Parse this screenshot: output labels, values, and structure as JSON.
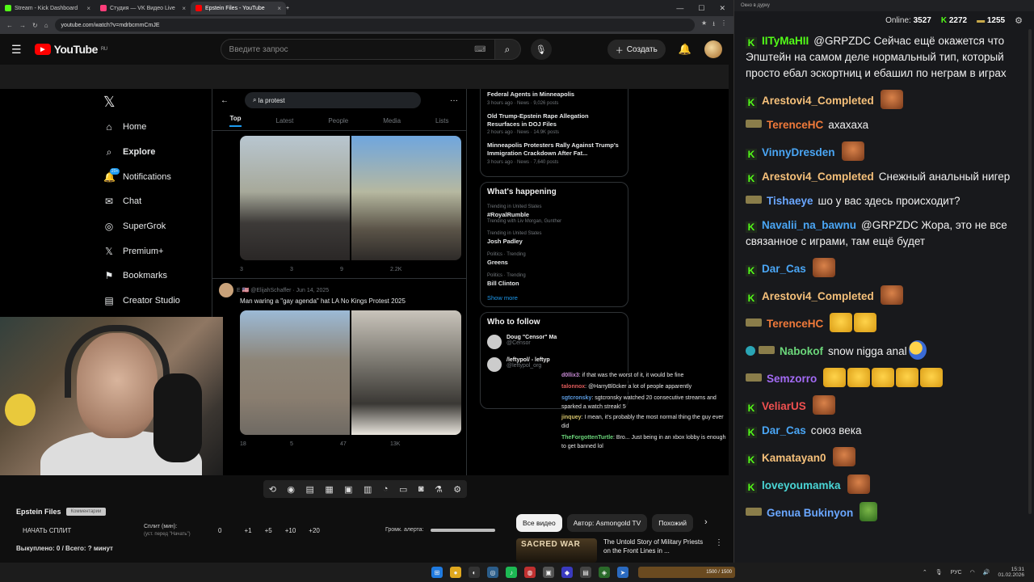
{
  "browser": {
    "tabs": [
      {
        "label": "Stream - Kick Dashboard",
        "color": "#53fc18"
      },
      {
        "label": "Студия — VK Видео Live",
        "color": "#ff3d7a"
      },
      {
        "label": "Epstein Files - YouTube",
        "color": "#ff0000"
      }
    ],
    "url": "youtube.com/watch?v=mdrbcmmCmJE"
  },
  "youtube": {
    "logo": "YouTube",
    "region": "RU",
    "search_placeholder": "Введите запрос",
    "create_label": "Создать",
    "video_title": "Epstein Files",
    "tag_label": "Комментарии",
    "split_button": "НАЧАТЬ СПЛИТ",
    "split_label": "Сплит (мин):",
    "split_hint": "(уст. перед \"Начать\")",
    "split_values": [
      "0",
      "+1",
      "+5",
      "+10",
      "+20"
    ],
    "alert_label": "Громк. алерта:",
    "bought": "Выкуплено: 0 / Всего: ? минут",
    "chips": [
      "Все видео",
      "Автор: Asmongold TV",
      "Похожий"
    ],
    "rec_thumb": "SACRED WAR",
    "rec_title": "The Untold Story of Military Priests on the Front Lines in ..."
  },
  "x": {
    "nav": [
      "Home",
      "Explore",
      "Notifications",
      "Chat",
      "SuperGrok",
      "Premium+",
      "Bookmarks",
      "Creator Studio"
    ],
    "notif_badge": "20+",
    "search_value": "la protest",
    "tabs": [
      "Top",
      "Latest",
      "People",
      "Media",
      "Lists"
    ],
    "tweet1_actions": [
      "3",
      "3",
      "9",
      "2.2K"
    ],
    "tweet2_handle": "E 🇺🇸 @ElijahSchaffer · Jun 14, 2025",
    "tweet2_text": "Man waring a \"gay agenda\" hat LA No Kings Protest 2025",
    "tweet2_actions": [
      "18",
      "5",
      "47",
      "13K"
    ],
    "news": [
      {
        "title": "Federal Agents in Minneapolis",
        "meta": "3 hours ago · News · 9,026 posts"
      },
      {
        "title": "Old Trump-Epstein Rape Allegation Resurfaces in DOJ Files",
        "meta": "2 hours ago · News · 14.9K posts"
      },
      {
        "title": "Minneapolis Protesters Rally Against Trump's Immigration Crackdown After Fat...",
        "meta": "3 hours ago · News · 7,640 posts"
      }
    ],
    "whats_happening": "What's happening",
    "trends": [
      {
        "cat": "Trending in United States",
        "name": "#RoyalRumble",
        "sub": "Trending with Liv Morgan, Gunther"
      },
      {
        "cat": "Trending in United States",
        "name": "Josh Padley",
        "sub": ""
      },
      {
        "cat": "Politics · Trending",
        "name": "Greens",
        "sub": ""
      },
      {
        "cat": "Politics · Trending",
        "name": "Bill Clinton",
        "sub": ""
      }
    ],
    "show_more": "Show more",
    "who_to_follow": "Who to follow",
    "follow": [
      {
        "name": "Doug \"Censor\" Ma",
        "handle": "@Censor"
      },
      {
        "name": "/leftypol/ - leftyp",
        "handle": "@leftypol_org"
      }
    ]
  },
  "overlay_chat": [
    {
      "user": "d0llix3",
      "text": "if that was the worst of it, it would be fine",
      "color": "#c98bd6"
    },
    {
      "user": "talonnox",
      "text": "@HarryBl0cker a lot of people apparently",
      "color": "#e05b5b"
    },
    {
      "user": "sgtcronsky",
      "text": "sgtcronsky watched 20 consecutive streams and sparked a watch streak! 5",
      "color": "#5b9be0"
    },
    {
      "user": "jinquey",
      "text": "I mean, it's probably the most normal thing the guy ever did",
      "color": "#d6c36b"
    },
    {
      "user": "TheForgottenTurtle",
      "text": "Bro... Just being in an xbox lobby is enough to get banned lol",
      "color": "#6bd67a"
    }
  ],
  "kick": {
    "window_title": "Окно в дурку",
    "online_label": "Online:",
    "online": "3527",
    "followers": "2272",
    "subs": "1255",
    "messages": [
      {
        "user": "IITyMaHII",
        "color": "#53fc18",
        "badge": "k",
        "text": "@GRPZDC Сейчас ещё окажется что Эпштейн на самом деле нормальный тип, который просто ебал эскортниц и ебашил по неграм в играх",
        "emotes": 0,
        "emote": ""
      },
      {
        "user": "Arestovi4_Completed",
        "color": "#f5c07a",
        "badge": "k",
        "text": "",
        "emotes": 1,
        "emote": ""
      },
      {
        "user": "TerenceHC",
        "color": "#f07a3a",
        "badge": "g",
        "text": "ахахаха",
        "emotes": 0,
        "emote": ""
      },
      {
        "user": "VinnyDresden",
        "color": "#4aa6f5",
        "badge": "k",
        "text": "",
        "emotes": 1,
        "emote": ""
      },
      {
        "user": "Arestovi4_Completed",
        "color": "#f5c07a",
        "badge": "k",
        "text": "Снежный анальный нигер",
        "emotes": 0,
        "emote": ""
      },
      {
        "user": "Tishaeye",
        "color": "#6aa7ff",
        "badge": "g",
        "text": "шо у вас здесь происходит?",
        "emotes": 0,
        "emote": ""
      },
      {
        "user": "Navalii_na_bawnu",
        "color": "#4aa6f5",
        "badge": "k",
        "text": "@GRPZDC Жора, это не все связанное с играми, там ещё будет",
        "emotes": 0,
        "emote": ""
      },
      {
        "user": "Dar_Cas",
        "color": "#4aa6f5",
        "badge": "k",
        "text": "",
        "emotes": 1,
        "emote": ""
      },
      {
        "user": "Arestovi4_Completed",
        "color": "#f5c07a",
        "badge": "k",
        "text": "",
        "emotes": 1,
        "emote": ""
      },
      {
        "user": "TerenceHC",
        "color": "#f07a3a",
        "badge": "g",
        "text": "",
        "emotes": 2,
        "emote": "lol"
      },
      {
        "user": "Nabokof",
        "color": "#6bd67a",
        "badge": "v",
        "text": "snow nigga anal",
        "emotes": 1,
        "emote": "blue"
      },
      {
        "user": "Semzorro",
        "color": "#a36bf5",
        "badge": "g",
        "text": "",
        "emotes": 5,
        "emote": "lol"
      },
      {
        "user": "VeliarUS",
        "color": "#f05050",
        "badge": "k",
        "text": "",
        "emotes": 1,
        "emote": ""
      },
      {
        "user": "Dar_Cas",
        "color": "#4aa6f5",
        "badge": "k",
        "text": "союз века",
        "emotes": 0,
        "emote": ""
      },
      {
        "user": "Kamatayan0",
        "color": "#f5c07a",
        "badge": "k",
        "text": "",
        "emotes": 1,
        "emote": ""
      },
      {
        "user": "loveyoumamka",
        "color": "#4ad6d6",
        "badge": "k",
        "text": "",
        "emotes": 1,
        "emote": ""
      },
      {
        "user": "Genua Bukinyon",
        "color": "#6aa7ff",
        "badge": "g",
        "text": "",
        "emotes": 1,
        "emote": "green"
      }
    ]
  },
  "taskbar": {
    "lang": "РУС",
    "time": "15:31",
    "date": "01.02.2026",
    "ls_bar": "1500 / 1500"
  }
}
